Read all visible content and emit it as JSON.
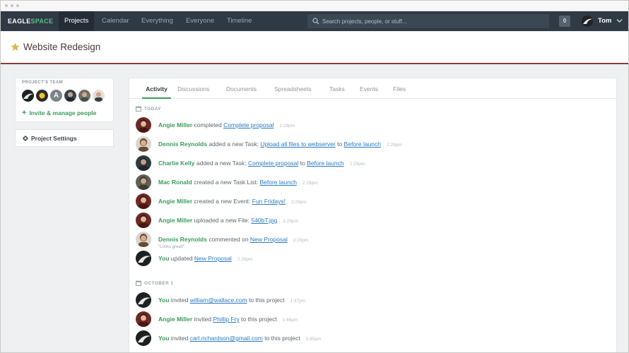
{
  "app": {
    "logo_left": "EAGLE",
    "logo_right": "SPACE",
    "nav": [
      "Projects",
      "Calendar",
      "Everything",
      "Everyone",
      "Timeline"
    ],
    "search_placeholder": "Search projects, people, or stuff...",
    "notifications": "0",
    "user_name": "Tom"
  },
  "project": {
    "title": "Website Redesign",
    "team_label": "PROJECT'S TEAM",
    "team_letter": "A",
    "invite_label": "Invite & manage people",
    "settings_label": "Project Settings"
  },
  "tabs": [
    "Activity",
    "Discussions",
    "Documents",
    "Spreadsheets",
    "Tasks",
    "Events",
    "Files"
  ],
  "feed": {
    "today_label": "TODAY",
    "today": [
      {
        "who": "Angie Miller",
        "t1": " completed ",
        "l1": "Complete proposal",
        "t2": "",
        "l2": "",
        "time": "2:29pm"
      },
      {
        "who": "Dennis Reynolds",
        "t1": " added a new Task: ",
        "l1": "Upload all files to webserver",
        "t2": " to ",
        "l2": "Before launch",
        "time": "2:29pm"
      },
      {
        "who": "Charlie Kelly",
        "t1": " added a new Task: ",
        "l1": "Complete proposal",
        "t2": " to ",
        "l2": "Before launch",
        "time": "2:29pm"
      },
      {
        "who": "Mac Ronald",
        "t1": " created a new Task List: ",
        "l1": "Before launch",
        "t2": "",
        "l2": "",
        "time": "2:29pm"
      },
      {
        "who": "Angie Miller",
        "t1": " created a new Event: ",
        "l1": "Fun Fridays!",
        "t2": "",
        "l2": "",
        "time": "2:29pm"
      },
      {
        "who": "Angie Miller",
        "t1": " uploaded a new File: ",
        "l1": "540bT.jpg",
        "t2": "",
        "l2": "",
        "time": "2:29pm"
      },
      {
        "who": "Dennis Reynolds",
        "t1": " commented on ",
        "l1": "New Proposal",
        "t2": "",
        "l2": "",
        "time": "2:28pm",
        "quote": "\"Looks great!\""
      },
      {
        "who": "You",
        "t1": " updated ",
        "l1": "New Proposal",
        "t2": "",
        "l2": "",
        "time": "2:28pm"
      }
    ],
    "oct_label": "OCTOBER 1",
    "october": [
      {
        "who": "You",
        "t1": " invited ",
        "l1": "william@wallace.com",
        "t2": " to this project",
        "l2": "",
        "time": "1:47pm"
      },
      {
        "who": "Angie Miller",
        "t1": " invited ",
        "l1": "Phillip Fry",
        "t2": " to this project",
        "l2": "",
        "time": "1:46pm"
      },
      {
        "who": "You",
        "t1": " invited ",
        "l1": "carl.richardson@gmail.com",
        "t2": " to this project",
        "l2": "",
        "time": "1:45pm"
      }
    ]
  },
  "colors": {
    "navbar": "#2f3a45",
    "accent_green": "#3a9c5b",
    "link_blue": "#2b7bbf",
    "header_rule": "#8a3b3b",
    "star": "#e0b64a"
  }
}
